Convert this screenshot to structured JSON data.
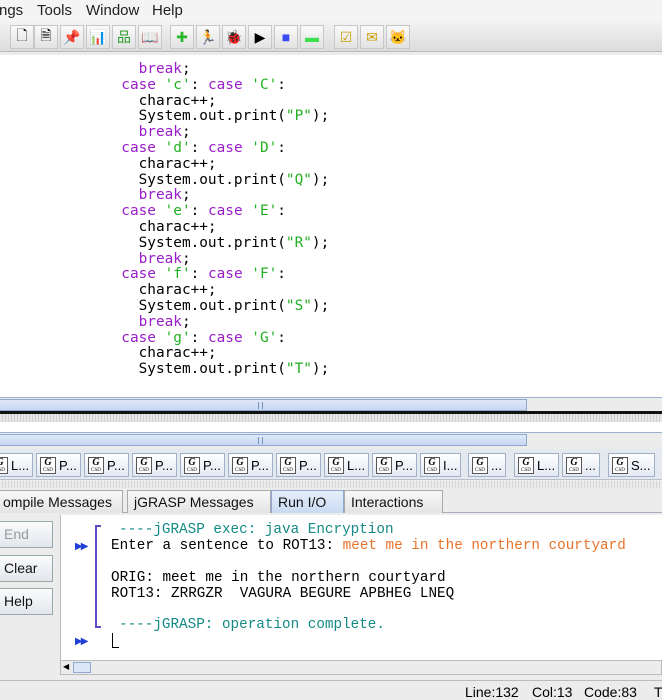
{
  "menu": [
    "ngs",
    "Tools",
    "Window",
    "Help"
  ],
  "toolbar_icons": [
    "new-file-icon",
    "new-doc-icon",
    "pin-icon",
    "bar-chart-icon",
    "hierarchy-icon",
    "book-icon",
    "compile-plus-icon",
    "run-figure-icon",
    "debug-bug-icon",
    "presentation-icon",
    "blue-square-icon",
    "green-square-icon",
    "check-doc-icon",
    "check-folder-icon",
    "cat-icon"
  ],
  "code": [
    {
      "indent": "      ",
      "parts": [
        [
          "kw",
          "break"
        ],
        [
          "",
          ";"
        ]
      ]
    },
    {
      "indent": "    ",
      "parts": [
        [
          "kw",
          "case"
        ],
        [
          "",
          " "
        ],
        [
          "str",
          "'c'"
        ],
        [
          "",
          ": "
        ],
        [
          "kw",
          "case"
        ],
        [
          "",
          " "
        ],
        [
          "str",
          "'C'"
        ],
        [
          "",
          ":"
        ]
      ]
    },
    {
      "indent": "      ",
      "parts": [
        [
          "",
          "charac++;"
        ]
      ]
    },
    {
      "indent": "      ",
      "parts": [
        [
          "",
          "System.out.print("
        ],
        [
          "str",
          "\"P\""
        ],
        [
          "",
          ");"
        ]
      ]
    },
    {
      "indent": "      ",
      "parts": [
        [
          "kw",
          "break"
        ],
        [
          "",
          ";"
        ]
      ]
    },
    {
      "indent": "    ",
      "parts": [
        [
          "kw",
          "case"
        ],
        [
          "",
          " "
        ],
        [
          "str",
          "'d'"
        ],
        [
          "",
          ": "
        ],
        [
          "kw",
          "case"
        ],
        [
          "",
          " "
        ],
        [
          "str",
          "'D'"
        ],
        [
          "",
          ":"
        ]
      ]
    },
    {
      "indent": "      ",
      "parts": [
        [
          "",
          "charac++;"
        ]
      ]
    },
    {
      "indent": "      ",
      "parts": [
        [
          "",
          "System.out.print("
        ],
        [
          "str",
          "\"Q\""
        ],
        [
          "",
          ");"
        ]
      ]
    },
    {
      "indent": "      ",
      "parts": [
        [
          "kw",
          "break"
        ],
        [
          "",
          ";"
        ]
      ]
    },
    {
      "indent": "    ",
      "parts": [
        [
          "kw",
          "case"
        ],
        [
          "",
          " "
        ],
        [
          "str",
          "'e'"
        ],
        [
          "",
          ": "
        ],
        [
          "kw",
          "case"
        ],
        [
          "",
          " "
        ],
        [
          "str",
          "'E'"
        ],
        [
          "",
          ":"
        ]
      ]
    },
    {
      "indent": "      ",
      "parts": [
        [
          "",
          "charac++;"
        ]
      ]
    },
    {
      "indent": "      ",
      "parts": [
        [
          "",
          "System.out.print("
        ],
        [
          "str",
          "\"R\""
        ],
        [
          "",
          ");"
        ]
      ]
    },
    {
      "indent": "      ",
      "parts": [
        [
          "kw",
          "break"
        ],
        [
          "",
          ";"
        ]
      ]
    },
    {
      "indent": "    ",
      "parts": [
        [
          "kw",
          "case"
        ],
        [
          "",
          " "
        ],
        [
          "str",
          "'f'"
        ],
        [
          "",
          ": "
        ],
        [
          "kw",
          "case"
        ],
        [
          "",
          " "
        ],
        [
          "str",
          "'F'"
        ],
        [
          "",
          ":"
        ]
      ]
    },
    {
      "indent": "      ",
      "parts": [
        [
          "",
          "charac++;"
        ]
      ]
    },
    {
      "indent": "      ",
      "parts": [
        [
          "",
          "System.out.print("
        ],
        [
          "str",
          "\"S\""
        ],
        [
          "",
          ");"
        ]
      ]
    },
    {
      "indent": "      ",
      "parts": [
        [
          "kw",
          "break"
        ],
        [
          "",
          ";"
        ]
      ]
    },
    {
      "indent": "    ",
      "parts": [
        [
          "kw",
          "case"
        ],
        [
          "",
          " "
        ],
        [
          "str",
          "'g'"
        ],
        [
          "",
          ": "
        ],
        [
          "kw",
          "case"
        ],
        [
          "",
          " "
        ],
        [
          "str",
          "'G'"
        ],
        [
          "",
          ":"
        ]
      ]
    },
    {
      "indent": "      ",
      "parts": [
        [
          "",
          "charac++;"
        ]
      ]
    },
    {
      "indent": "      ",
      "parts": [
        [
          "",
          "System.out.print("
        ],
        [
          "str",
          "\"T\""
        ],
        [
          "",
          ");"
        ]
      ]
    }
  ],
  "file_tabs": [
    "L...",
    "P...",
    "P...",
    "P...",
    "P...",
    "P...",
    "P...",
    "L...",
    "P...",
    "I...",
    "...",
    "L...",
    "...",
    "S..."
  ],
  "message_tabs": [
    "ompile Messages",
    "jGRASP Messages",
    "Run I/O",
    "Interactions"
  ],
  "active_message_tab": "Run I/O",
  "buttons": {
    "end": "End",
    "clear": "Clear",
    "help": "Help"
  },
  "run_io": {
    "exec_line": "----jGRASP exec: java Encryption",
    "prompt": "Enter a sentence to ROT13: ",
    "input": "meet me in the northern courtyard",
    "orig": "ORIG: meet me in the northern courtyard",
    "rot": "ROT13: ZRRGZR  VAGURA BEGURE APBHEG LNEQ",
    "complete": "----jGRASP: operation complete."
  },
  "status": {
    "line": "Line:132",
    "col": "Col:13",
    "code": "Code:83",
    "extra": "T"
  }
}
